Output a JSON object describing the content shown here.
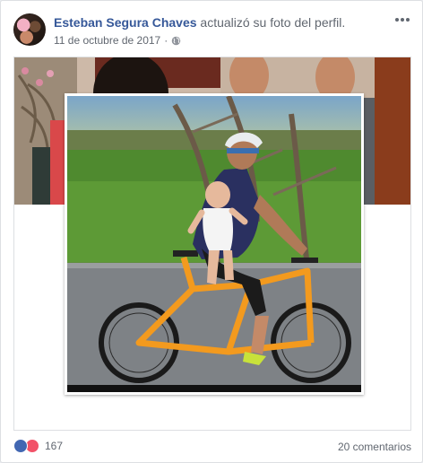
{
  "post": {
    "author": "Esteban Segura Chaves",
    "action": "actualizó su foto del perfil.",
    "date": "11 de octubre de 2017",
    "separator": "·",
    "privacy_icon": "globe-icon",
    "menu_icon": "more-options-icon"
  },
  "reactions": {
    "icons": [
      "like-icon",
      "love-icon"
    ],
    "count": "167",
    "comments": "20 comentarios"
  },
  "colors": {
    "link": "#365899",
    "meta": "#616770",
    "like": "#4267b2",
    "love": "#f25268",
    "bike_orange": "#f39a1e"
  }
}
